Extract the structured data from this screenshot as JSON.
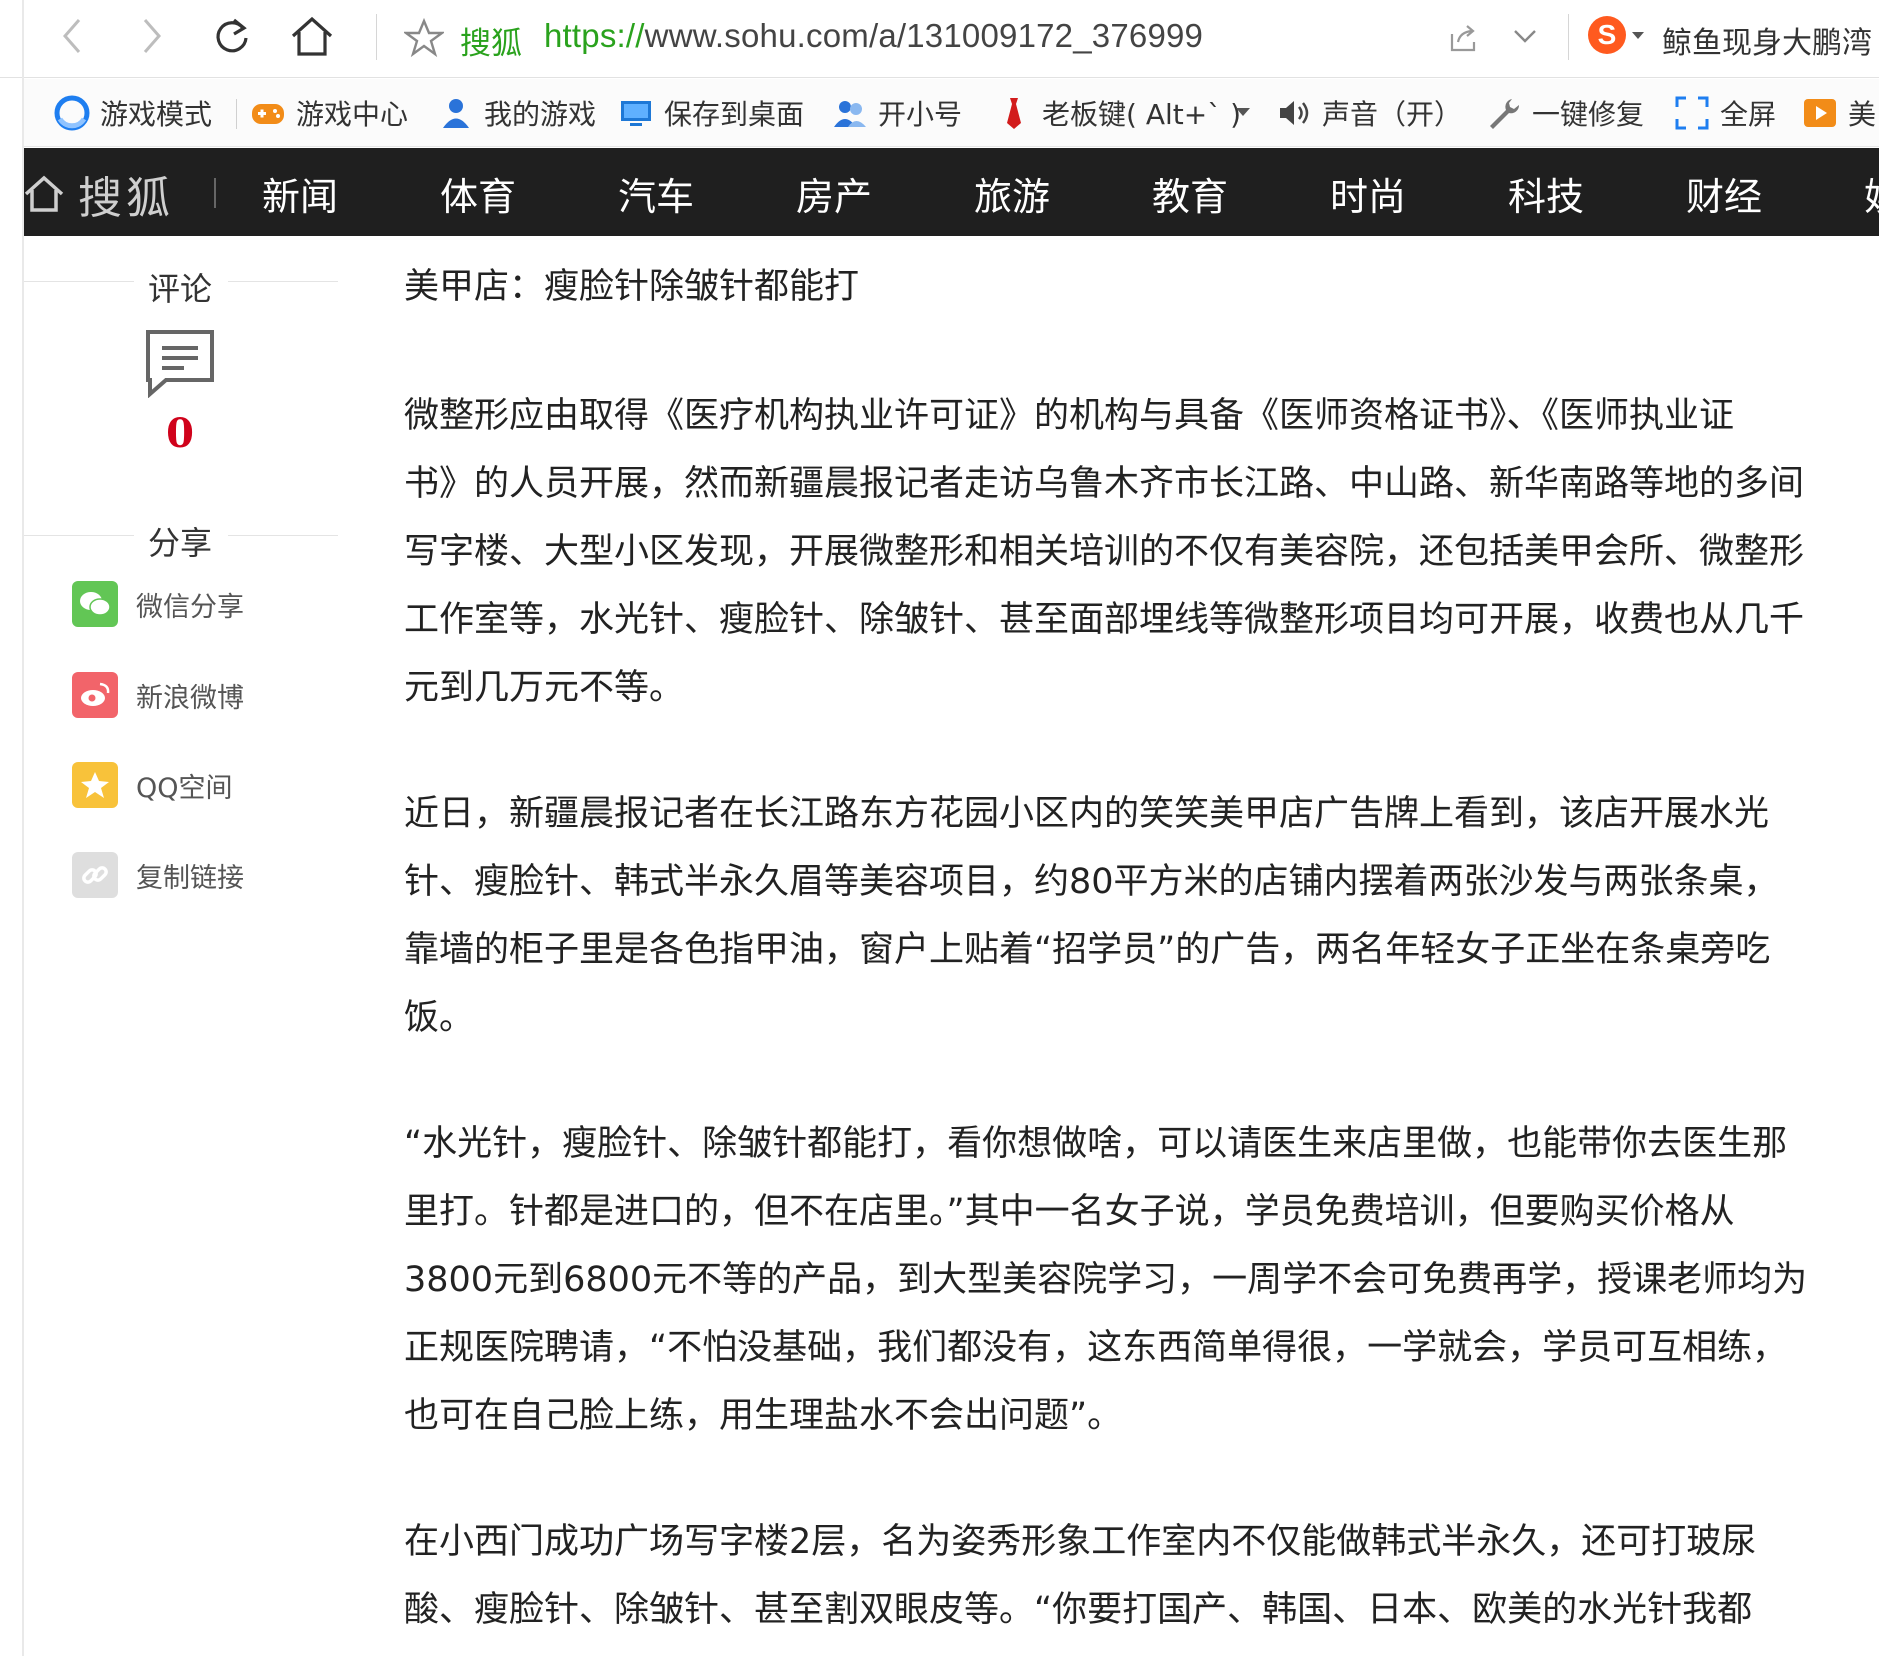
{
  "browser": {
    "site_tag": "搜狐",
    "url_protocol": "https://",
    "url_rest": "www.sohu.com/a/131009172_376999",
    "hot_news": "鲸鱼现身大鹏湾"
  },
  "toolbar": {
    "items": [
      {
        "label": "游戏模式",
        "icon": "game-mode-icon"
      },
      {
        "label": "游戏中心",
        "icon": "gamepad-icon"
      },
      {
        "label": "我的游戏",
        "icon": "user-icon"
      },
      {
        "label": "保存到桌面",
        "icon": "desktop-icon"
      },
      {
        "label": "开小号",
        "icon": "users-icon"
      },
      {
        "label": "老板键( Alt+` )",
        "icon": "tie-icon"
      },
      {
        "label": "声音（开）",
        "icon": "speaker-icon"
      },
      {
        "label": "一键修复",
        "icon": "wrench-icon"
      },
      {
        "label": "全屏",
        "icon": "fullscreen-icon"
      },
      {
        "label": "美",
        "icon": "video-icon"
      }
    ]
  },
  "sohu_nav": {
    "brand": "搜狐",
    "channels": [
      "新闻",
      "体育",
      "汽车",
      "房产",
      "旅游",
      "教育",
      "时尚",
      "科技",
      "财经",
      "娱"
    ]
  },
  "sidebar": {
    "comment_title": "评论",
    "comment_count": "0",
    "share_title": "分享",
    "share_items": [
      {
        "label": "微信分享",
        "color": "#62c655",
        "icon": "wechat-icon"
      },
      {
        "label": "新浪微博",
        "color": "#f2646a",
        "icon": "weibo-icon"
      },
      {
        "label": "QQ空间",
        "color": "#f8c23a",
        "icon": "qzone-icon"
      },
      {
        "label": "复制链接",
        "color": "#dedede",
        "icon": "link-icon"
      }
    ]
  },
  "article": {
    "headline": "美甲店：瘦脸针除皱针都能打",
    "paragraphs": [
      [
        "微整形应由取得《医疗机构执业许可证》的机构与具备《医师资格证书》、《医师执业证",
        "书》的人员开展，然而新疆晨报记者走访乌鲁木齐市长江路、中山路、新华南路等地的多间",
        "写字楼、大型小区发现，开展微整形和相关培训的不仅有美容院，还包括美甲会所、微整形",
        "工作室等，水光针、瘦脸针、除皱针、甚至面部埋线等微整形项目均可开展，收费也从几千",
        "元到几万元不等。"
      ],
      [
        "近日，新疆晨报记者在长江路东方花园小区内的笑笑美甲店广告牌上看到，该店开展水光",
        "针、瘦脸针、韩式半永久眉等美容项目，约80平方米的店铺内摆着两张沙发与两张条桌，",
        "靠墙的柜子里是各色指甲油，窗户上贴着“招学员”的广告，两名年轻女子正坐在条桌旁吃",
        "饭。"
      ],
      [
        "“水光针，瘦脸针、除皱针都能打，看你想做啥，可以请医生来店里做，也能带你去医生那",
        "里打。针都是进口的，但不在店里。”其中一名女子说，学员免费培训，但要购买价格从",
        "3800元到6800元不等的产品，到大型美容院学习，一周学不会可免费再学，授课老师均为",
        "正规医院聘请，“不怕没基础，我们都没有，这东西简单得很，一学就会，学员可互相练，",
        "也可在自己脸上练，用生理盐水不会出问题”。"
      ],
      [
        "在小西门成功广场写字楼2层，名为姿秀形象工作室内不仅能做韩式半永久，还可打玻尿",
        "酸、瘦脸针、除皱针、甚至割双眼皮等。“你要打国产、韩国、日本、欧美的水光针我都"
      ]
    ]
  }
}
